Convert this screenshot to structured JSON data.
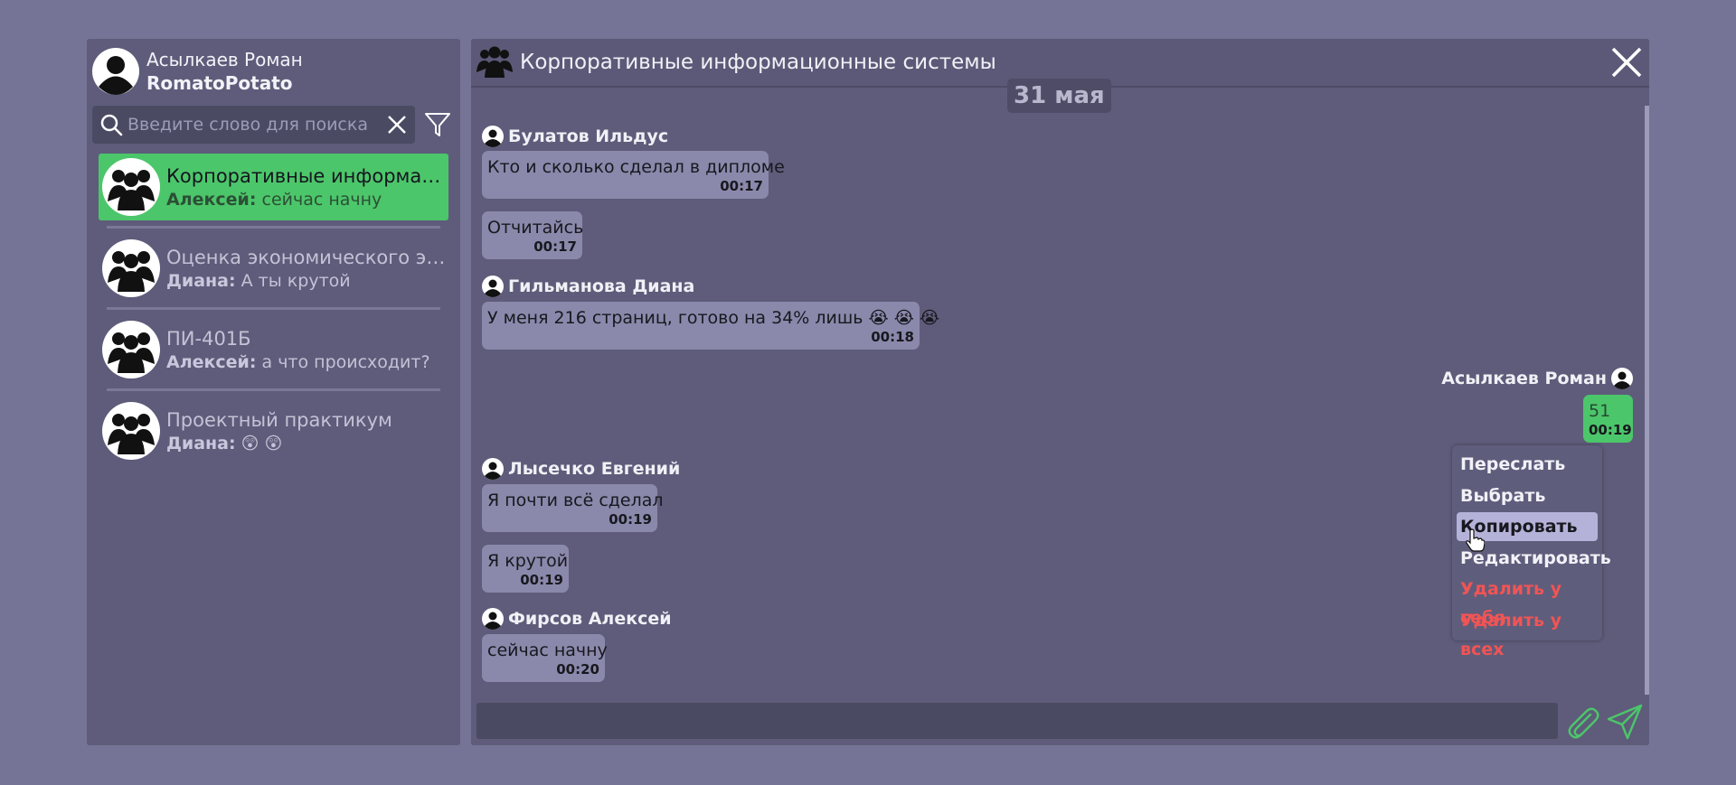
{
  "user": {
    "name": "Асылкаев Роман",
    "login": "RomatoPotato"
  },
  "search": {
    "placeholder": "Введите слово для поиска"
  },
  "chats": [
    {
      "title": "Корпоративные информаци...",
      "author": "Алексей:",
      "last": " сейчас начну",
      "active": true
    },
    {
      "title": "Оценка экономического эф...",
      "author": "Диана:",
      "last": " А ты крутой",
      "active": false
    },
    {
      "title": "ПИ-401Б",
      "author": "Алексей:",
      "last": " а что происходит?",
      "active": false
    },
    {
      "title": "Проектный практикум",
      "author": "Диана:",
      "last": " 😲 😲",
      "active": false
    }
  ],
  "chat": {
    "title": "Корпоративные информационные системы",
    "date": "31 мая"
  },
  "messages": {
    "bulatov": {
      "author": "Булатов Ильдус",
      "m1": {
        "text": "Кто и сколько сделал в дипломе",
        "time": "00:17"
      },
      "m2": {
        "text": "Отчитайсь",
        "time": "00:17"
      }
    },
    "gilmanova": {
      "author": "Гильманова Диана",
      "m1": {
        "text": "У меня 216 страниц, готово на 34% лишь 😭 😭 😭",
        "time": "00:18"
      }
    },
    "own": {
      "author": "Асылкаев Роман",
      "m1": {
        "text": "51",
        "time": "00:19"
      }
    },
    "lysechko": {
      "author": "Лысечко Евгений",
      "m1": {
        "text": "Я почти всё сделал",
        "time": "00:19"
      },
      "m2": {
        "text": "Я крутой",
        "time": "00:19"
      }
    },
    "firsov": {
      "author": "Фирсов Алексей",
      "m1": {
        "text": "сейчас начну",
        "time": "00:20"
      }
    }
  },
  "context_menu": {
    "forward": "Переслать",
    "select": "Выбрать",
    "copy": "Копировать",
    "edit": "Редактировать",
    "delete_self": "Удалить у себя",
    "delete_all": "Удалить у всех"
  },
  "colors": {
    "background": "#757496",
    "panel": "#5e5c7a",
    "accent_green": "#4cc66a",
    "bubble": "#8a89ab",
    "danger": "#f15454"
  }
}
